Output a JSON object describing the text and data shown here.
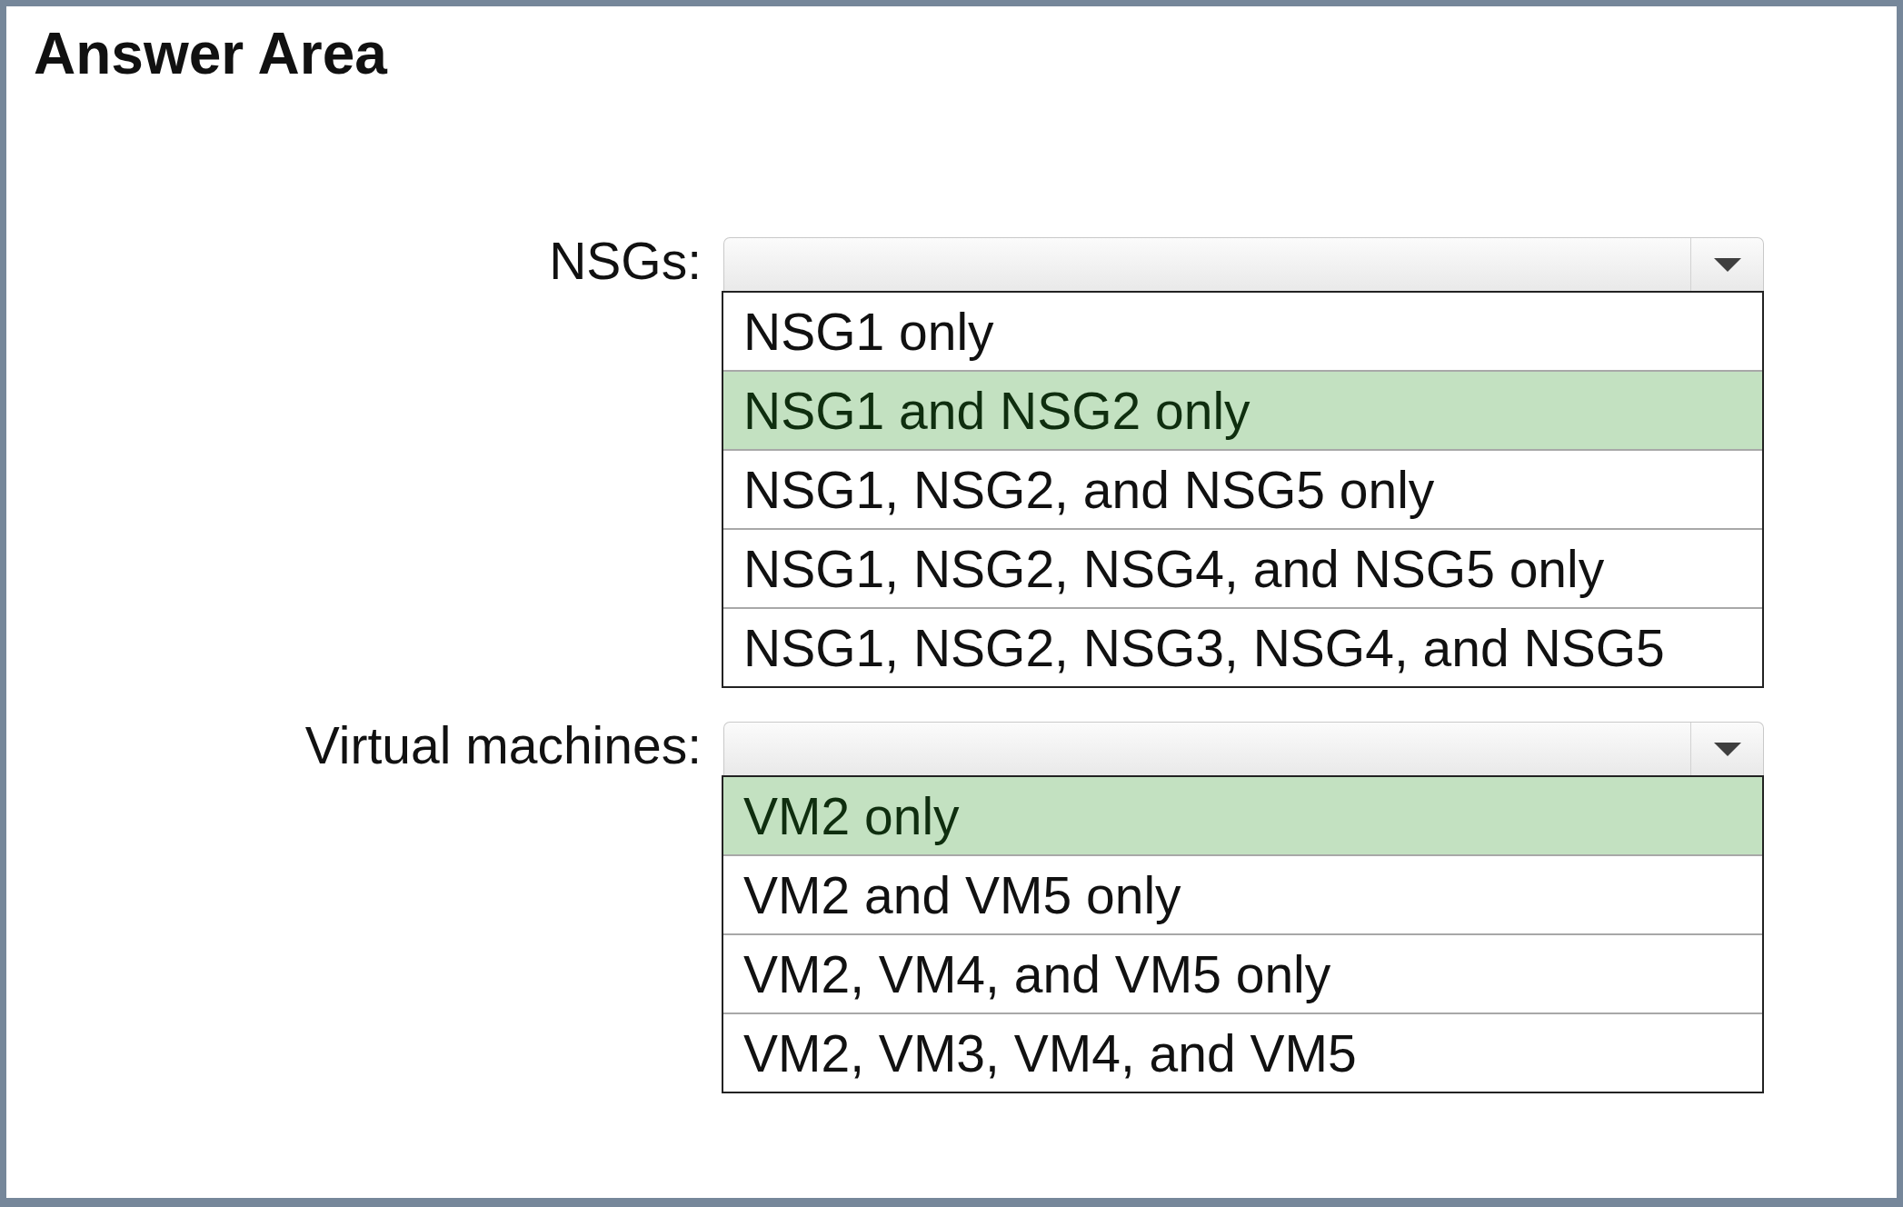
{
  "title": "Answer Area",
  "questions": [
    {
      "label": "NSGs:",
      "dropdown": {
        "expanded": true
      },
      "options": [
        {
          "text": "NSG1 only",
          "selected": false
        },
        {
          "text": "NSG1 and NSG2 only",
          "selected": true
        },
        {
          "text": "NSG1, NSG2, and NSG5 only",
          "selected": false
        },
        {
          "text": "NSG1, NSG2, NSG4, and NSG5 only",
          "selected": false
        },
        {
          "text": "NSG1, NSG2, NSG3, NSG4, and NSG5",
          "selected": false
        }
      ]
    },
    {
      "label": "Virtual machines:",
      "dropdown": {
        "expanded": true
      },
      "options": [
        {
          "text": "VM2 only",
          "selected": true
        },
        {
          "text": "VM2 and VM5 only",
          "selected": false
        },
        {
          "text": "VM2, VM4, and VM5 only",
          "selected": false
        },
        {
          "text": "VM2, VM3, VM4, and VM5",
          "selected": false
        }
      ]
    }
  ]
}
